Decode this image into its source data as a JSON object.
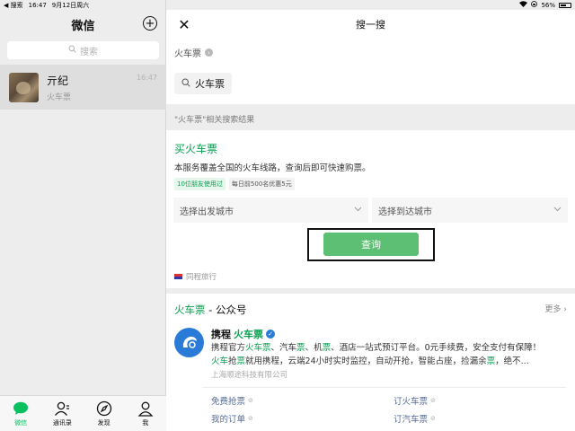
{
  "status_bar": {
    "back_app": "◀ 搜索",
    "time": "16:47",
    "date": "9月12日周六",
    "battery_text": "56%",
    "battery_level": 0.56
  },
  "left_panel": {
    "title": "微信",
    "search_placeholder": "搜索",
    "chat": {
      "name": "亓纪",
      "preview": "火车票",
      "time": "16:47"
    },
    "tabs": [
      {
        "label": "微信"
      },
      {
        "label": "通讯录"
      },
      {
        "label": "发现"
      },
      {
        "label": "我"
      }
    ]
  },
  "search_page": {
    "title": "搜一搜",
    "breadcrumb": "火车票",
    "query_chip": "火车票",
    "section_label": "\"火车票\"相关搜索结果",
    "service": {
      "title": "买火车票",
      "description": "本服务覆盖全国的火车线路，查询后即可快速购票。",
      "badge_friends": "10位朋友使用过",
      "badge_offer": "每日前500名优惠5元",
      "from_placeholder": "选择出发城市",
      "to_placeholder": "选择到达城市",
      "query_button": "查询",
      "provider": "同程旅行"
    },
    "accounts": {
      "heading_keyword": "火车票",
      "heading_rest": " - 公众号",
      "more": "更多",
      "account_name_prefix": "携程",
      "account_name_keyword": "火车票",
      "desc_line1": "携程官方火车票、汽车票、机票、酒店一站式预订平台。0元手续费，安全支付有保障！",
      "desc_line2": "火车抢票就用携程，云端24小时实时监控，自动开抢，智能占座，捡漏余票，绝不...",
      "company": "上海顺途科技有限公司",
      "menu": [
        "免费抢票",
        "订火车票",
        "我的订单",
        "订汽车票"
      ]
    }
  },
  "colors": {
    "accent_green": "#07c160",
    "highlight_green": "#07a150",
    "button_green": "#5cbf73",
    "link_blue": "#576b95"
  }
}
